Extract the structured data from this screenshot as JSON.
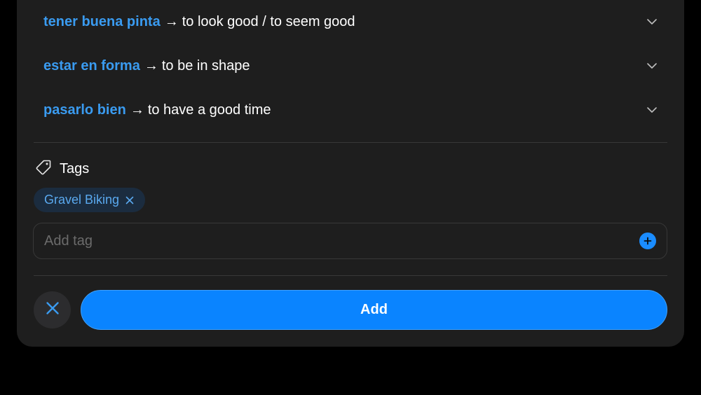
{
  "phrases": [
    {
      "spanish": "tener buena pinta",
      "arrow": "→",
      "english": "to look good / to seem good",
      "chevron_icon": "chevron-down-icon"
    },
    {
      "spanish": "estar en forma",
      "arrow": "→",
      "english": "to be in shape",
      "chevron_icon": "chevron-down-icon"
    },
    {
      "spanish": "pasarlo bien",
      "arrow": "→",
      "english": "to have a good time",
      "chevron_icon": "chevron-down-icon"
    }
  ],
  "tags": {
    "title": "Tags",
    "icon": "tag-icon",
    "chips": [
      {
        "label": "Gravel Biking",
        "remove_icon": "close-icon"
      }
    ],
    "input": {
      "placeholder": "Add tag",
      "value": "",
      "add_icon": "plus-circle-icon"
    }
  },
  "actions": {
    "cancel_icon": "close-icon",
    "add_label": "Add"
  },
  "colors": {
    "background": "#000000",
    "card": "#1e1e1e",
    "accent": "#0a84ff",
    "phrase_blue": "#3a9bf0",
    "chip_bg": "#1b2c3f",
    "divider": "#383838"
  }
}
